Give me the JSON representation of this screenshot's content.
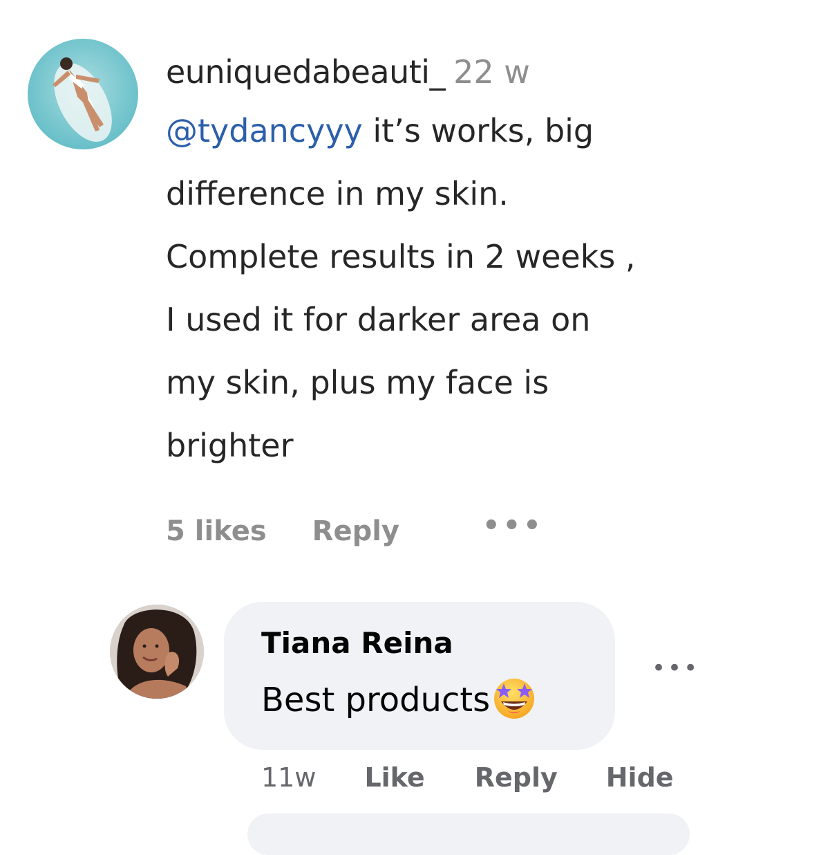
{
  "comment_ig": {
    "avatar_icon": "profile-photo",
    "username": "euniquedabeauti_",
    "time": "22 w",
    "mention": "@tydancyyy",
    "text_lines": [
      " it’s works, big",
      "difference in my skin.",
      "Complete results in 2 weeks ,",
      "I used it for darker area on",
      "my skin, plus my face is",
      "brighter"
    ],
    "likes": "5 likes",
    "reply_label": "Reply",
    "more_icon": "more-options-icon",
    "mention_color": "#2b5faa"
  },
  "comment_fb": {
    "avatar_icon": "profile-photo",
    "name": "Tiana Reina",
    "text": "Best products",
    "emoji_icon": "star-struck-emoji",
    "time": "11w",
    "like_label": "Like",
    "reply_label": "Reply",
    "hide_label": "Hide",
    "more_icon": "more-options-icon",
    "bubble_color": "#f0f2f5"
  }
}
